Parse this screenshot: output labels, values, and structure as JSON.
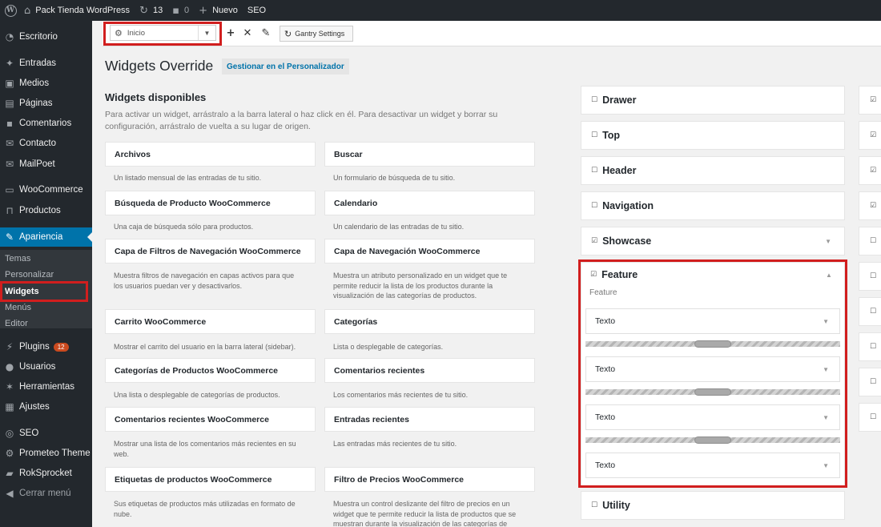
{
  "adminbar": {
    "site_name": "Pack Tienda WordPress",
    "updates_count": "13",
    "comments_count": "0",
    "new_label": "Nuevo",
    "seo_label": "SEO"
  },
  "sidebar": {
    "items": [
      {
        "label": "Escritorio",
        "icon": "dashboard-icon"
      },
      {
        "label": "Entradas",
        "icon": "pin-icon"
      },
      {
        "label": "Medios",
        "icon": "media-icon"
      },
      {
        "label": "Páginas",
        "icon": "pages-icon"
      },
      {
        "label": "Comentarios",
        "icon": "comment-icon"
      },
      {
        "label": "Contacto",
        "icon": "mail-icon"
      },
      {
        "label": "MailPoet",
        "icon": "mail-icon"
      },
      {
        "label": "WooCommerce",
        "icon": "woocommerce-icon"
      },
      {
        "label": "Productos",
        "icon": "cart-icon"
      },
      {
        "label": "Apariencia",
        "icon": "brush-icon"
      },
      {
        "label": "Plugins",
        "icon": "plugin-icon",
        "badge": "12"
      },
      {
        "label": "Usuarios",
        "icon": "user-icon"
      },
      {
        "label": "Herramientas",
        "icon": "wrench-icon"
      },
      {
        "label": "Ajustes",
        "icon": "settings-icon"
      },
      {
        "label": "SEO",
        "icon": "seo-icon"
      },
      {
        "label": "Prometeo Theme",
        "icon": "gear-icon"
      },
      {
        "label": "RokSprocket",
        "icon": "sprocket-icon"
      },
      {
        "label": "Cerrar menú",
        "icon": "collapse-icon"
      }
    ],
    "submenu": [
      "Temas",
      "Personalizar",
      "Widgets",
      "Menús",
      "Editor"
    ]
  },
  "toolbar": {
    "selected_override": "Inicio",
    "gantry_settings": "Gantry Settings"
  },
  "main": {
    "title": "Widgets Override",
    "customize_link": "Gestionar en el Personalizador",
    "available_title": "Widgets disponibles",
    "available_desc": "Para activar un widget, arrástralo a la barra lateral o haz click en él. Para desactivar un widget y borrar su configuración, arrástralo de vuelta a su lugar de origen.",
    "widgets": [
      {
        "name": "Archivos",
        "desc": "Un listado mensual de las entradas de tu sitio."
      },
      {
        "name": "Buscar",
        "desc": "Un formulario de búsqueda de tu sitio."
      },
      {
        "name": "Búsqueda de Producto WooCommerce",
        "desc": "Una caja de búsqueda sólo para productos."
      },
      {
        "name": "Calendario",
        "desc": "Un calendario de las entradas de tu sitio."
      },
      {
        "name": "Capa de Filtros de Navegación WooCommerce",
        "desc": "Muestra filtros de navegación en capas activos para que los usuarios puedan ver y desactivarlos."
      },
      {
        "name": "Capa de Navegación WooCommerce",
        "desc": "Muestra un atributo personalizado en un widget que te permite reducir la lista de los productos durante la visualización de las categorías de productos."
      },
      {
        "name": "Carrito WooCommerce",
        "desc": "Mostrar el carrito del usuario en la barra lateral (sidebar)."
      },
      {
        "name": "Categorías",
        "desc": "Lista o desplegable de categorías."
      },
      {
        "name": "Categorías de Productos WooCommerce",
        "desc": "Una lista o desplegable de categorías de productos."
      },
      {
        "name": "Comentarios recientes",
        "desc": "Los comentarios más recientes de tu sitio."
      },
      {
        "name": "Comentarios recientes WooCommerce",
        "desc": "Mostrar una lista de los comentarios más recientes en su web."
      },
      {
        "name": "Entradas recientes",
        "desc": "Las entradas más recientes de tu sitio."
      },
      {
        "name": "Etiquetas de productos WooCommerce",
        "desc": "Sus etiquetas de productos más utilizadas en formato de nube."
      },
      {
        "name": "Filtro de Precios WooCommerce",
        "desc": "Muestra un control deslizante del filtro de precios en un widget que te permite reducir la lista de productos que se muestran durante la visualización de las categorías de"
      }
    ]
  },
  "areas": [
    {
      "name": "Drawer",
      "checked": false
    },
    {
      "name": "Top",
      "checked": false
    },
    {
      "name": "Header",
      "checked": false
    },
    {
      "name": "Navigation",
      "checked": false
    },
    {
      "name": "Showcase",
      "checked": true
    },
    {
      "name": "Feature",
      "checked": true,
      "subtitle": "Feature"
    },
    {
      "name": "Utility",
      "checked": false
    }
  ],
  "feature_widgets": [
    "Texto",
    "Texto",
    "Texto",
    "Texto"
  ],
  "colors": {
    "admin_bg": "#23282d",
    "accent": "#0073aa",
    "highlight": "#d11e1e",
    "badge": "#ca4a1f"
  }
}
